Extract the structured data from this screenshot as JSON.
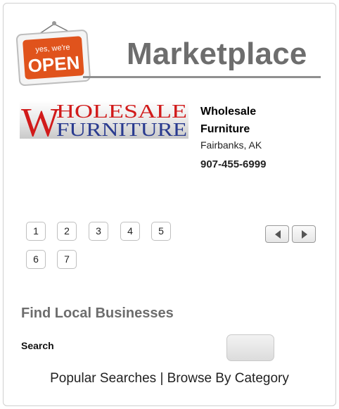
{
  "header": {
    "sign_top": "yes, we're",
    "sign_main": "OPEN",
    "title": "Marketplace"
  },
  "listing": {
    "logo_line1": "HOLESALE",
    "logo_line2": "FURNITURE",
    "logo_initial": "W",
    "name": "Wholesale Furniture",
    "location": "Fairbanks, AK",
    "phone": "907-455-6999"
  },
  "pagination": {
    "pages": [
      "1",
      "2",
      "3",
      "4",
      "5",
      "6",
      "7"
    ]
  },
  "find": {
    "heading": "Find Local Businesses",
    "search_label": "Search",
    "popular": "Popular Searches",
    "separator": "|",
    "browse": "Browse By Category"
  },
  "colors": {
    "sign_orange": "#e0531c",
    "heading_gray": "#6d6d6d",
    "logo_red": "#d11a1a",
    "logo_blue": "#2a3b8f"
  },
  "icons": [
    "open-sign-icon",
    "arrow-left-icon",
    "arrow-right-icon"
  ]
}
